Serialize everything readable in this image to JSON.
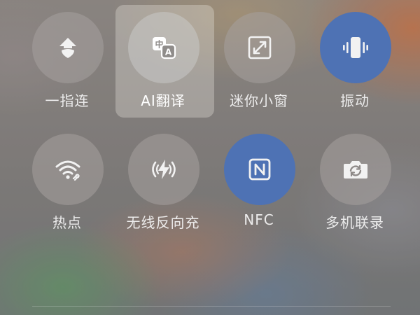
{
  "control_center": {
    "tiles": [
      {
        "label": "一指连",
        "icon": "cloud-upload-icon",
        "active": false
      },
      {
        "label": "AI翻译",
        "icon": "translate-icon",
        "active": false,
        "highlighted": true
      },
      {
        "label": "迷你小窗",
        "icon": "mini-window-icon",
        "active": false
      },
      {
        "label": "振动",
        "icon": "vibrate-icon",
        "active": true
      },
      {
        "label": "热点",
        "icon": "hotspot-icon",
        "active": false
      },
      {
        "label": "无线反向充",
        "icon": "reverse-wireless-charge-icon",
        "active": false
      },
      {
        "label": "NFC",
        "icon": "nfc-icon",
        "active": true
      },
      {
        "label": "多机联录",
        "icon": "multi-camera-icon",
        "active": false
      }
    ]
  },
  "colors": {
    "active_blue": "#4e72b4",
    "tile_label": "#f5f5f5"
  }
}
